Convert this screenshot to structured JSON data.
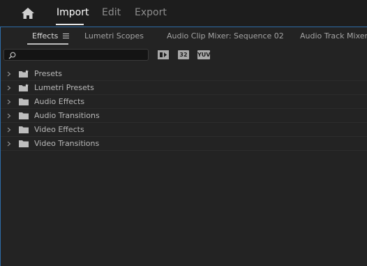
{
  "topnav": {
    "home_icon": "home-icon",
    "items": [
      {
        "label": "Import",
        "active": true
      },
      {
        "label": "Edit",
        "active": false
      },
      {
        "label": "Export",
        "active": false
      }
    ]
  },
  "panel": {
    "tabs": [
      {
        "label": "Effects",
        "active": true
      },
      {
        "label": "Lumetri Scopes",
        "active": false
      },
      {
        "label": "Audio Clip Mixer: Sequence 02",
        "active": false
      },
      {
        "label": "Audio Track Mixer:",
        "active": false
      }
    ],
    "menu_icon": "hamburger-menu-icon"
  },
  "toolbar": {
    "search": {
      "value": "",
      "placeholder": ""
    },
    "filters": [
      {
        "label": "",
        "icon": "accelerated-effects-icon"
      },
      {
        "label": "32",
        "icon": "32-bit-color-icon"
      },
      {
        "label": "YUV",
        "icon": "yuv-effects-icon"
      }
    ]
  },
  "tree": {
    "items": [
      {
        "label": "Presets",
        "icon": "preset-folder-icon"
      },
      {
        "label": "Lumetri Presets",
        "icon": "preset-folder-icon"
      },
      {
        "label": "Audio Effects",
        "icon": "folder-icon"
      },
      {
        "label": "Audio Transitions",
        "icon": "folder-icon"
      },
      {
        "label": "Video Effects",
        "icon": "folder-icon"
      },
      {
        "label": "Video Transitions",
        "icon": "folder-icon"
      }
    ]
  },
  "colors": {
    "background": "#1d1d1d",
    "panel": "#232323",
    "focus_border": "#2e6da8",
    "text": "#b9b9b9",
    "text_active": "#ffffff"
  }
}
